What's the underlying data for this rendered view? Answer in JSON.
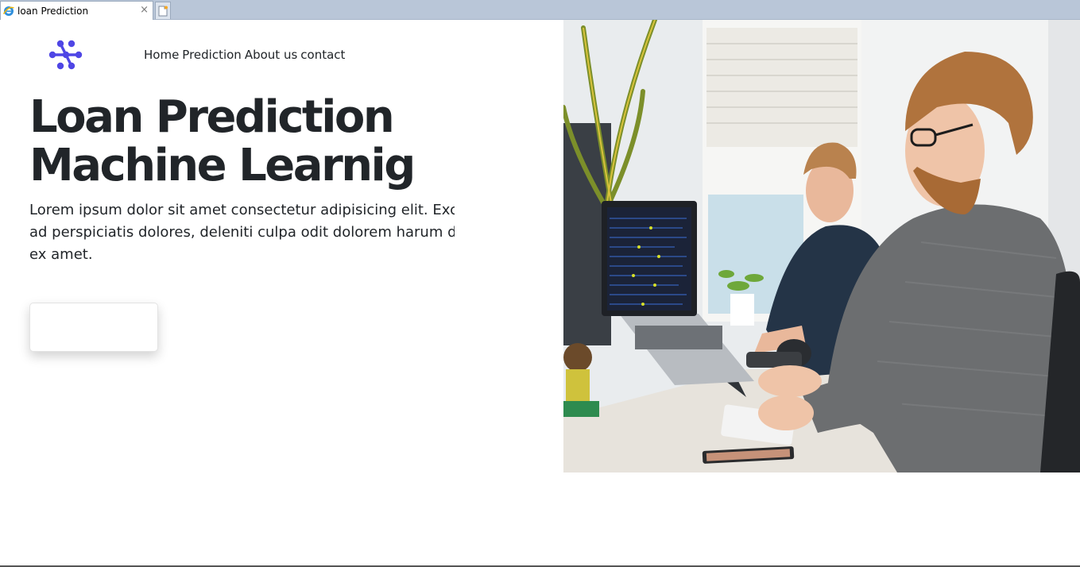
{
  "browser": {
    "tab_title": "loan Prediction",
    "close_glyph": "×"
  },
  "nav": {
    "items": [
      "Home",
      "Prediction",
      "About us",
      "contact"
    ]
  },
  "hero": {
    "title_lines": [
      "Loan Prediction",
      "Machine Learnig"
    ],
    "description_lines": [
      "Lorem ipsum dolor sit amet consectetur adipisicing elit. Excep",
      "ad perspiciatis dolores, deleniti culpa odit dolorem harum do",
      "ex amet."
    ],
    "button_label": ""
  },
  "colors": {
    "brand": "#4f46e5",
    "text": "#212529"
  },
  "icons": {
    "logo": "dots-logo-icon",
    "favicon": "ie-icon",
    "new_tab": "new-tab-icon",
    "close": "close-icon"
  }
}
